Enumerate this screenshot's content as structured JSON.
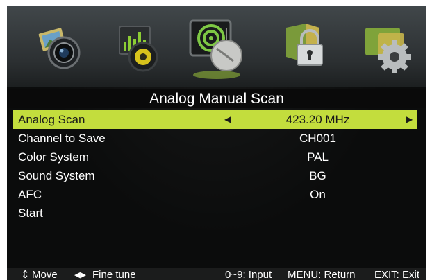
{
  "menu_icons": [
    {
      "name": "picture-icon"
    },
    {
      "name": "sound-icon"
    },
    {
      "name": "channel-icon"
    },
    {
      "name": "lock-icon"
    },
    {
      "name": "setup-icon"
    }
  ],
  "title": "Analog Manual Scan",
  "rows": [
    {
      "label": "Analog Scan",
      "value": "423.20 MHz"
    },
    {
      "label": "Channel to Save",
      "value": "CH001"
    },
    {
      "label": "Color System",
      "value": "PAL"
    },
    {
      "label": "Sound System",
      "value": "BG"
    },
    {
      "label": "AFC",
      "value": "On"
    },
    {
      "label": "Start",
      "value": ""
    }
  ],
  "footer": {
    "move": "Move",
    "fine_tune": "Fine tune",
    "input": "0~9: Input",
    "menu": "MENU: Return",
    "exit": "EXIT: Exit"
  },
  "colors": {
    "highlight": "#c3dd3d",
    "background": "#0b0c0c"
  }
}
